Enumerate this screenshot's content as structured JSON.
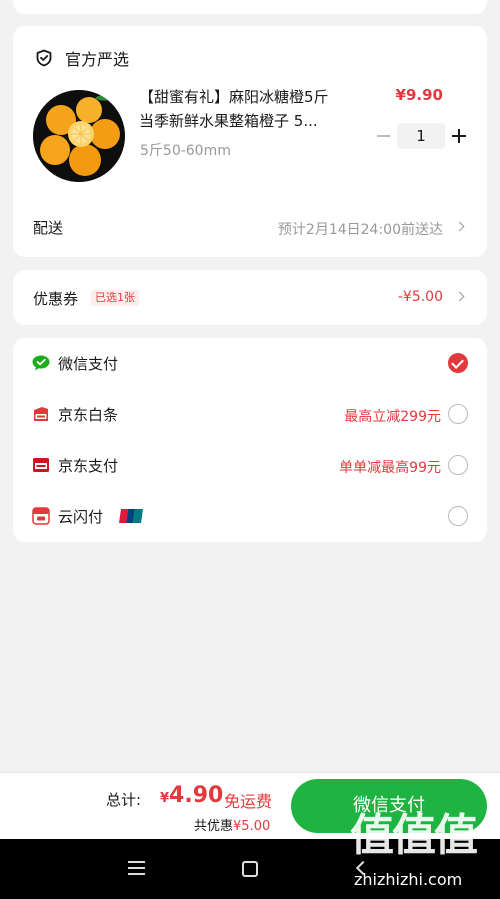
{
  "shop": {
    "name": "官方严选",
    "icon": "shield-check-icon"
  },
  "product": {
    "title_line1": "【甜蜜有礼】麻阳冰糖橙5斤",
    "title_line2": "当季新鲜水果整箱橙子 5...",
    "price": "¥9.90",
    "spec": "5斤50-60mm",
    "quantity": "1"
  },
  "delivery": {
    "label": "配送",
    "estimate": "预计2月14日24:00前送达"
  },
  "coupon": {
    "label": "优惠券",
    "tag": "已选1张",
    "discount": "-¥5.00"
  },
  "payment_methods": [
    {
      "name": "微信支付",
      "icon": "wechat-pay-icon",
      "promo": "",
      "selected": true
    },
    {
      "name": "京东白条",
      "icon": "jd-baitiao-icon",
      "promo": "最高立减299元",
      "selected": false
    },
    {
      "name": "京东支付",
      "icon": "jd-pay-icon",
      "promo": "单单减最高99元",
      "selected": false
    },
    {
      "name": "云闪付",
      "icon": "unionpay-quickpass-icon",
      "promo": "",
      "selected": false
    }
  ],
  "footer": {
    "total_label": "总计:",
    "currency": "¥",
    "total_amount": "4.90",
    "free_shipping": "免运费",
    "saved_label": "共优惠",
    "saved_amount": "¥5.00",
    "pay_button": "微信支付"
  },
  "watermark": {
    "logo": "值值值",
    "site": "zhizhizhi.com"
  },
  "colors": {
    "accent_red": "#e4393c",
    "pay_green": "#1fb342",
    "wechat_green": "#1aad19"
  }
}
